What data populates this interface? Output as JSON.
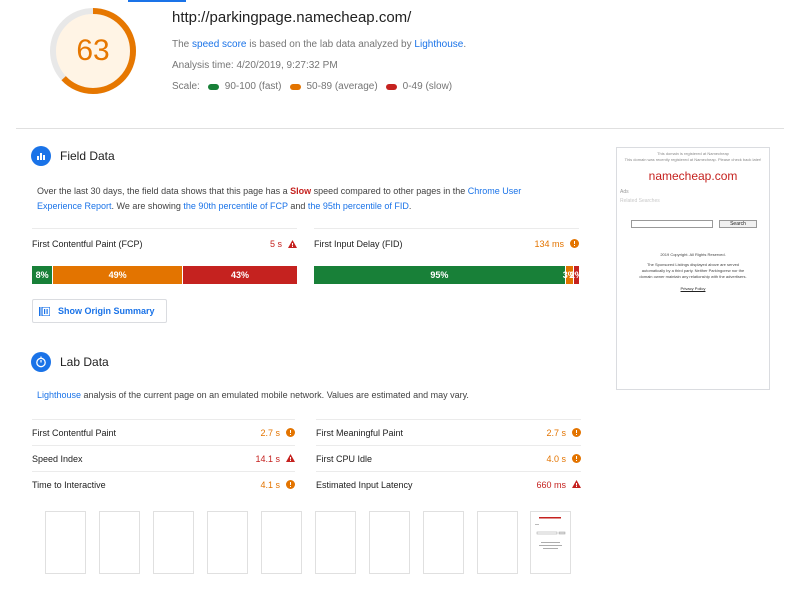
{
  "summary": {
    "score": "63",
    "score_fraction": 0.63,
    "url": "http://parkingpage.namecheap.com/",
    "desc_prefix": "The ",
    "desc_link1": "speed score",
    "desc_middle": " is based on the lab data analyzed by ",
    "desc_link2": "Lighthouse",
    "desc_suffix": ".",
    "analysis_time": "Analysis time: 4/20/2019, 9:27:32 PM",
    "scale_label": "Scale:",
    "scale_fast": "90-100 (fast)",
    "scale_average": "50-89 (average)",
    "scale_slow": "0-49 (slow)"
  },
  "colors": {
    "fast": "#188038",
    "average": "#e37400",
    "slow": "#c5221f",
    "accent": "#1a73e8",
    "gauge": "#e67700"
  },
  "field": {
    "title": "Field Data",
    "desc": {
      "t1": "Over the last 30 days, the field data shows that this page has a ",
      "slow": "Slow",
      "t2": " speed compared to other pages in the ",
      "link1": "Chrome User Experience Report",
      "t3": ". We are showing ",
      "link2": "the 90th percentile of FCP",
      "t4": " and ",
      "link3": "the 95th percentile of FID",
      "t5": "."
    },
    "fcp": {
      "label": "First Contentful Paint (FCP)",
      "value": "5 s",
      "status": "slow"
    },
    "fid": {
      "label": "First Input Delay (FID)",
      "value": "134 ms",
      "status": "average"
    },
    "fcp_dist": [
      {
        "label": "8%",
        "pct": 8,
        "cls": "g"
      },
      {
        "label": "49%",
        "pct": 49,
        "cls": "o"
      },
      {
        "label": "43%",
        "pct": 43,
        "cls": "r"
      }
    ],
    "fid_dist": [
      {
        "label": "95%",
        "pct": 95,
        "cls": "g"
      },
      {
        "label": "3%",
        "pct": 3,
        "cls": "o"
      },
      {
        "label": "2%",
        "pct": 2,
        "cls": "r"
      }
    ],
    "origin_button": "Show Origin Summary"
  },
  "lab": {
    "title": "Lab Data",
    "desc_link": "Lighthouse",
    "desc_rest": " analysis of the current page on an emulated mobile network. Values are estimated and may vary.",
    "metrics": [
      {
        "label": "First Contentful Paint",
        "value": "2.7 s",
        "status": "average"
      },
      {
        "label": "First Meaningful Paint",
        "value": "2.7 s",
        "status": "average"
      },
      {
        "label": "Speed Index",
        "value": "14.1 s",
        "status": "slow"
      },
      {
        "label": "First CPU Idle",
        "value": "4.0 s",
        "status": "average"
      },
      {
        "label": "Time to Interactive",
        "value": "4.1 s",
        "status": "average"
      },
      {
        "label": "Estimated Input Latency",
        "value": "660 ms",
        "status": "slow"
      }
    ]
  },
  "preview": {
    "line1": "This domain is registered at Namecheap",
    "line2": "This domain was recently registered at Namecheap. Please check back later!",
    "brand": "namecheap.com",
    "ads": "Ads",
    "related": "Related Searches",
    "search_btn": "Search",
    "copyright": "2019 Copyright. All Rights Reserved.",
    "disclaimer": "The Sponsored Listings displayed above are served automatically by a third party. Neither Parkingcrew nor the domain owner maintain any relationship with the advertisers.",
    "privacy": "Privacy Policy"
  }
}
